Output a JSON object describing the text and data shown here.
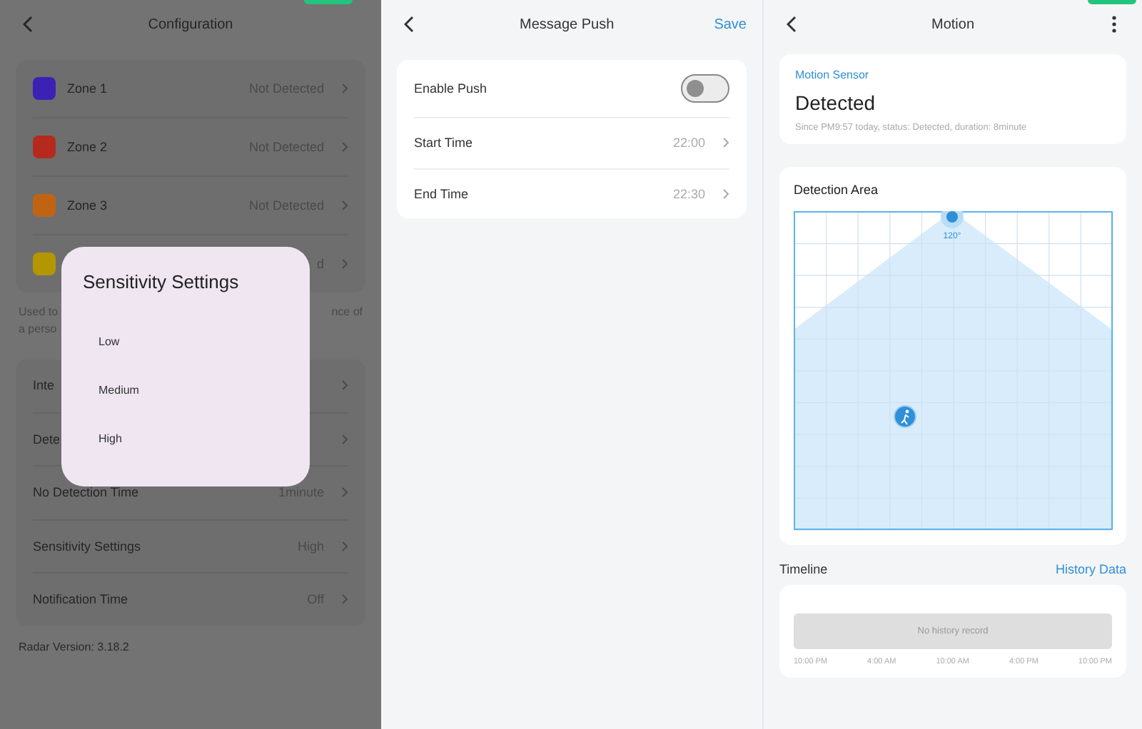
{
  "config_panel": {
    "title": "Configuration",
    "zones": [
      {
        "name": "Zone 1",
        "color": "#3b22b5",
        "value": "Not Detected"
      },
      {
        "name": "Zone 2",
        "color": "#b52a1c",
        "value": "Not Detected"
      },
      {
        "name": "Zone 3",
        "color": "#c06414",
        "value": "Not Detected"
      },
      {
        "color": "#b39600",
        "value": "d"
      }
    ],
    "description_lines": [
      {
        "left": "Used to",
        "right": "nce of"
      },
      {
        "left": "a perso"
      }
    ],
    "settings": [
      {
        "label": "Inte"
      },
      {
        "label": "Dete"
      },
      {
        "label": "No Detection Time",
        "value": "1minute"
      },
      {
        "label": "Sensitivity Settings",
        "value": "High"
      },
      {
        "label": "Notification Time",
        "value": "Off"
      }
    ],
    "version": "Radar Version: 3.18.2"
  },
  "sensitivity_dialog": {
    "title": "Sensitivity Settings",
    "options": [
      "Low",
      "Medium",
      "High"
    ]
  },
  "message_push": {
    "title": "Message Push",
    "save": "Save",
    "enable_push": {
      "label": "Enable Push",
      "on": false
    },
    "times": [
      {
        "label": "Start Time",
        "value": "22:00"
      },
      {
        "label": "End Time",
        "value": "22:30"
      }
    ]
  },
  "motion": {
    "title": "Motion",
    "sensor_label": "Motion Sensor",
    "status": "Detected",
    "since": "Since PM9:57 today, status: Detected, duration: 8minute",
    "area_title": "Detection Area",
    "angle": "120°",
    "timeline_label": "Timeline",
    "history_link": "History Data",
    "empty": "No history record",
    "time_ticks": [
      "10:00 PM",
      "4:00 AM",
      "10:00 AM",
      "4:00 PM",
      "10:00 PM"
    ]
  }
}
